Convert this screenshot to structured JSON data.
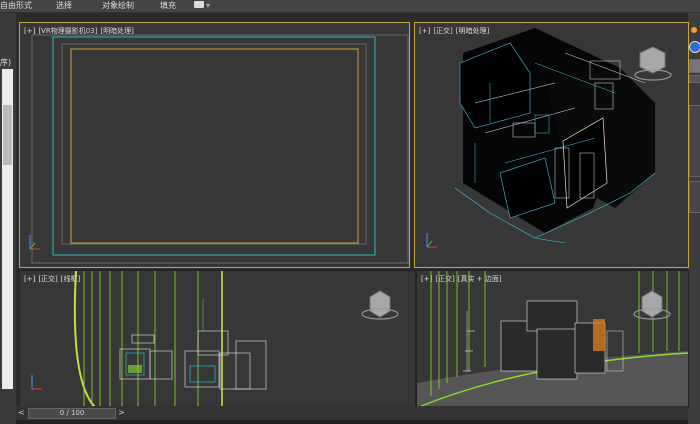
{
  "menu": [
    "自由形式",
    "选择",
    "对象绘制",
    "填充"
  ],
  "left_panel": {
    "label": "序)"
  },
  "viewports": [
    {
      "id": "top-left",
      "labels": [
        "[+]",
        "[VR物理摄影机03]",
        "[明暗处理]"
      ],
      "active": true
    },
    {
      "id": "top-right",
      "labels": [
        "[+]",
        "[正交]",
        "[明暗处理]"
      ],
      "active": false
    },
    {
      "id": "bottom-left",
      "labels": [
        "[+]",
        "[正交]",
        "[线框]"
      ],
      "active": false
    },
    {
      "id": "bottom-right",
      "labels": [
        "[+]",
        "[正交]",
        "[真实 + 边面]"
      ],
      "active": false
    }
  ],
  "timeline": {
    "frame_display": "0 / 100",
    "prev_symbol": "<",
    "next_symbol": ">"
  },
  "colors": {
    "active_border": "#c9a53a",
    "safe_frame_cyan": "#2fb4c4",
    "safe_frame_yellow": "#c9a53a",
    "wire_cyan": "#3cc8e0",
    "wire_white": "#e6e6e6",
    "wire_green": "#8adf2c"
  }
}
